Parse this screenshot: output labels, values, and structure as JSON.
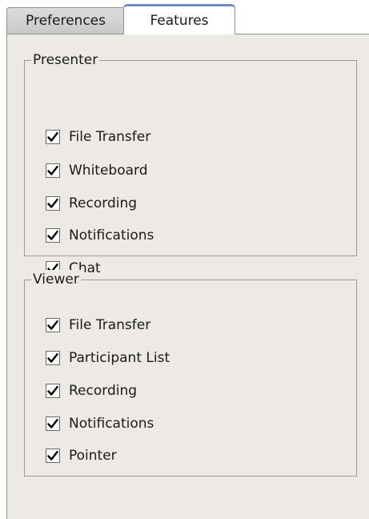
{
  "tabs": [
    {
      "label": "Preferences",
      "active": false
    },
    {
      "label": "Features",
      "active": true
    }
  ],
  "presenter": {
    "title": "Presenter",
    "items": [
      {
        "label": "File Transfer",
        "checked": true
      },
      {
        "label": "Whiteboard",
        "checked": true
      },
      {
        "label": "Recording",
        "checked": true
      },
      {
        "label": "Notifications",
        "checked": true
      },
      {
        "label": "Chat",
        "checked": true
      }
    ]
  },
  "viewer": {
    "title": "Viewer",
    "items": [
      {
        "label": "File Transfer",
        "checked": true
      },
      {
        "label": "Participant List",
        "checked": true
      },
      {
        "label": "Recording",
        "checked": true
      },
      {
        "label": "Notifications",
        "checked": true
      },
      {
        "label": "Pointer",
        "checked": true
      }
    ]
  },
  "colors": {
    "panel_background": "#ede9e4",
    "active_tab_accent": "#6f8fb8"
  }
}
